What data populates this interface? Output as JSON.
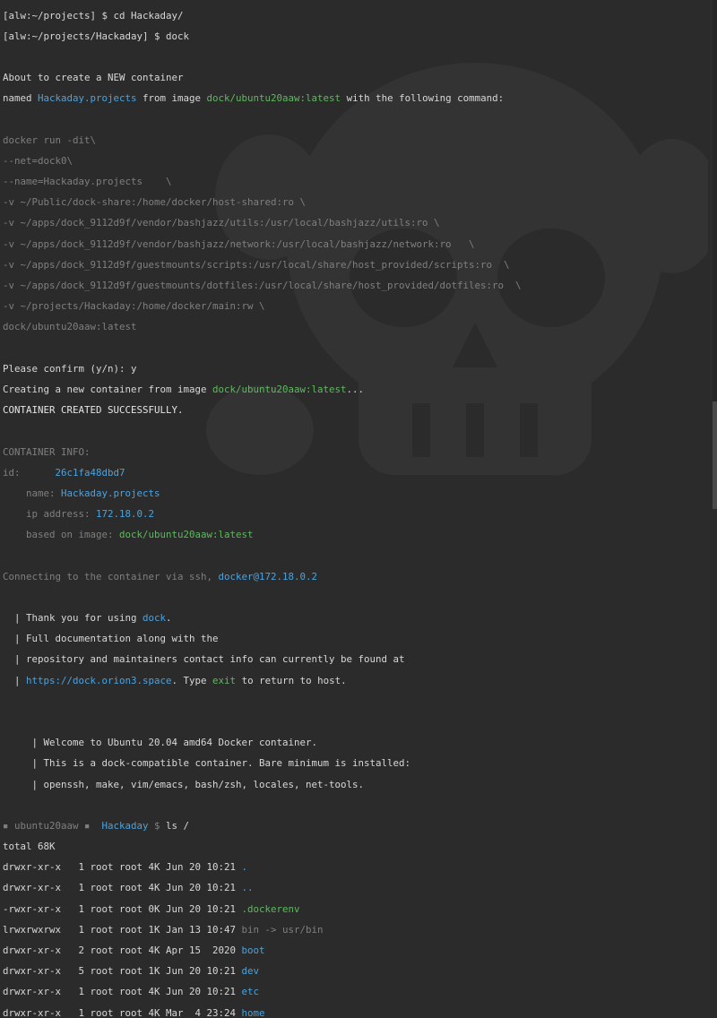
{
  "terminal": {
    "l01": "[alw:~/projects] $ cd Hackaday/",
    "l02": "[alw:~/projects/Hackaday] $ dock",
    "l03": "",
    "l04": "About to create a NEW container",
    "l05a": "named ",
    "l05b": "Hackaday.projects",
    "l05c": " from image ",
    "l05d": "dock/ubuntu20aaw:latest",
    "l05e": " with the following command:",
    "l06": "",
    "l07": "docker run -dit\\",
    "l08": "--net=dock0\\",
    "l09": "--name=Hackaday.projects    \\",
    "l10": "-v ~/Public/dock-share:/home/docker/host-shared:ro \\",
    "l11": "-v ~/apps/dock_9112d9f/vendor/bashjazz/utils:/usr/local/bashjazz/utils:ro \\",
    "l12": "-v ~/apps/dock_9112d9f/vendor/bashjazz/network:/usr/local/bashjazz/network:ro   \\",
    "l13": "-v ~/apps/dock_9112d9f/guestmounts/scripts:/usr/local/share/host_provided/scripts:ro  \\",
    "l14": "-v ~/apps/dock_9112d9f/guestmounts/dotfiles:/usr/local/share/host_provided/dotfiles:ro  \\",
    "l15": "-v ~/projects/Hackaday:/home/docker/main:rw \\",
    "l16": "dock/ubuntu20aaw:latest",
    "l17": "",
    "l18": "Please confirm (y/n): y",
    "l19a": "Creating a new container from image ",
    "l19b": "dock/ubuntu20aaw:latest",
    "l19c": "...",
    "l20": "CONTAINER CREATED SUCCESSFULLY.",
    "l21": "",
    "l22": "CONTAINER INFO:",
    "l23a": "id:      ",
    "l23b": "26c1fa48dbd7",
    "l24a": "    name: ",
    "l24b": "Hackaday.projects",
    "l25a": "    ip address: ",
    "l25b": "172.18.0.2",
    "l26a": "    based on image: ",
    "l26b": "dock/ubuntu20aaw:latest",
    "l27": "",
    "l28a": "Connecting to the container via ssh, ",
    "l28b": "docker@172.18.0.2",
    "l29": "",
    "l30a": "  | Thank you for using ",
    "l30b": "dock",
    "l30c": ".",
    "l31": "  | Full documentation along with the",
    "l32": "  | repository and maintainers contact info can currently be found at",
    "l33a": "  | ",
    "l33b": "https://dock.orion3.space",
    "l33c": ". Type ",
    "l33d": "exit",
    "l33e": " to return to host.",
    "l34": "",
    "l35": "",
    "l36": "     | Welcome to Ubuntu 20.04 amd64 Docker container.",
    "l37": "     | This is a dock-compatible container. Bare minimum is installed:",
    "l38": "     | openssh, make, vim/emacs, bash/zsh, locales, net-tools.",
    "l39": "",
    "l40a": "▪ ubuntu20aaw ▪  ",
    "l40b": "Hackaday",
    "l40c": " $ ",
    "l40d": "ls /",
    "l41": "total 68K",
    "ls": [
      {
        "perm": "drwxr-xr-x   1 root root 4K Jun 20 10:21 ",
        "name": ".",
        "extra": ""
      },
      {
        "perm": "drwxr-xr-x   1 root root 4K Jun 20 10:21 ",
        "name": "..",
        "extra": ""
      },
      {
        "perm": "-rwxr-xr-x   1 root root 0K Jun 20 10:21 ",
        "name": ".dockerenv",
        "extra": ""
      },
      {
        "perm": "lrwxrwxrwx   1 root root 1K Jan 13 10:47 ",
        "name": "bin",
        "extra": " -> usr/bin"
      },
      {
        "perm": "drwxr-xr-x   2 root root 4K Apr 15  2020 ",
        "name": "boot",
        "extra": ""
      },
      {
        "perm": "drwxr-xr-x   5 root root 1K Jun 20 10:21 ",
        "name": "dev",
        "extra": ""
      },
      {
        "perm": "drwxr-xr-x   1 root root 4K Jun 20 10:21 ",
        "name": "etc",
        "extra": ""
      },
      {
        "perm": "drwxr-xr-x   1 root root 4K Mar  4 23:24 ",
        "name": "home",
        "extra": ""
      }
    ]
  },
  "colors": {
    "background": "#2b2b2b",
    "text": "#d8d8d8",
    "dim": "#7f7f7f",
    "blue": "#4aa3df",
    "green": "#5fb95f"
  }
}
